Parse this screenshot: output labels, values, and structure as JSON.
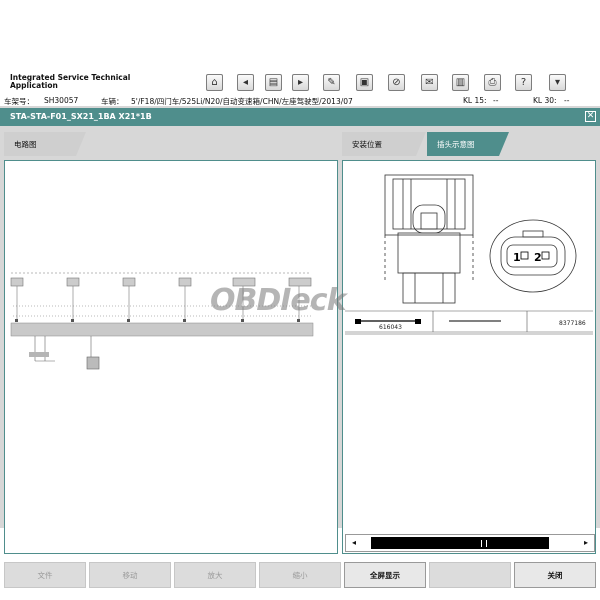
{
  "header": {
    "app_title": "Integrated Service Technical Application",
    "vin_label": "车架号：",
    "vin_value": "SH30057",
    "vehicle_label": "车辆：",
    "vehicle_value": "5'/F18/四门车/525Li/N20/自动变速箱/CHN/左座驾驶型/2013/07",
    "kl15_label": "KL 15:",
    "kl15_value": "--",
    "kl30_label": "KL 30:",
    "kl30_value": "--"
  },
  "toolbar": [
    "home-icon",
    "back-icon",
    "pages-icon",
    "forward-icon",
    "wrench-icon",
    "id-icon",
    "link-icon",
    "mail-icon",
    "book-icon",
    "print-icon",
    "help-icon",
    "minimize-icon"
  ],
  "title_bar": {
    "title": "STA-STA-F01_SX21_1BA X21*1B",
    "close": "✕"
  },
  "tabs": {
    "circuit": "电路图",
    "install": "安装位置",
    "connector": "插头示意图"
  },
  "connector_view": {
    "pin1": "1",
    "pin2": "2",
    "part1": "616043",
    "part2": "8377186"
  },
  "watermark": "OBDIeck",
  "buttons": {
    "file": "文件",
    "move": "移动",
    "zoom_in": "放大",
    "zoom_out": "缩小",
    "fullscreen": "全屏显示",
    "close": "关闭"
  }
}
